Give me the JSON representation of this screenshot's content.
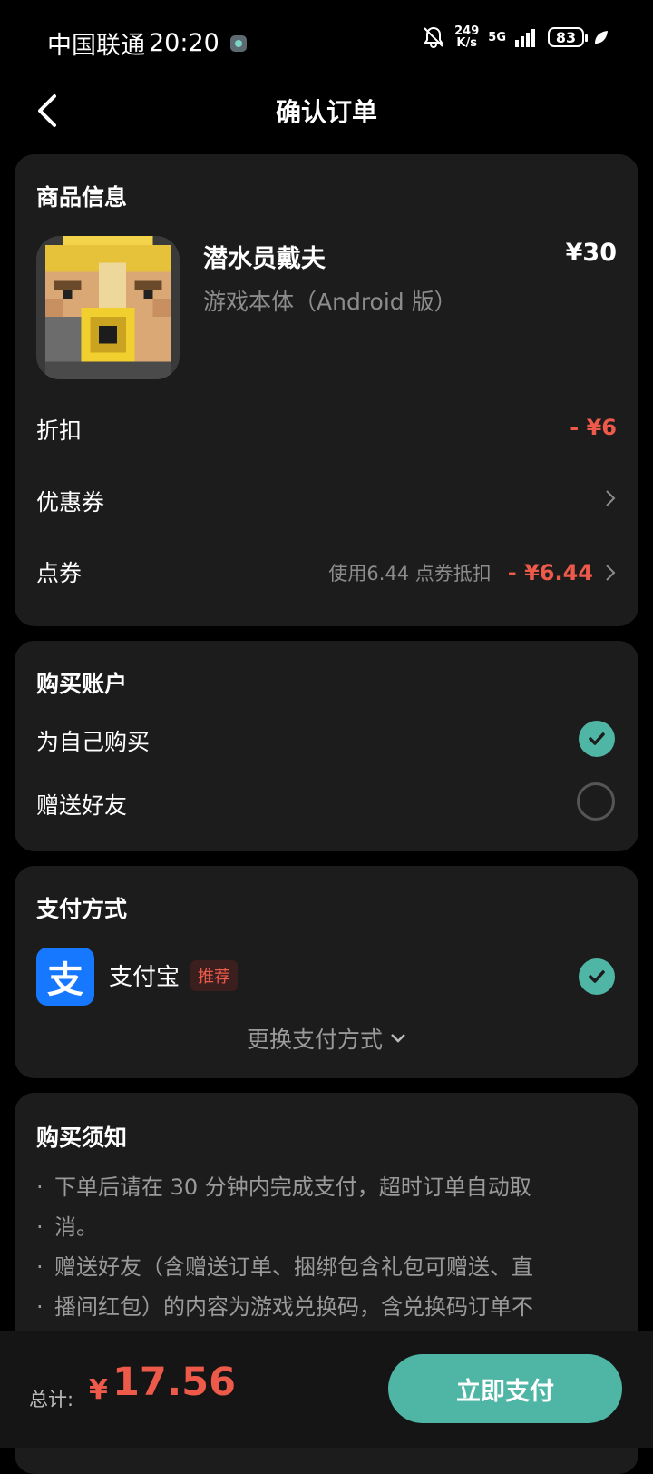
{
  "status_bar": {
    "carrier": "中国联通",
    "time": "20:20",
    "speed_top": "249",
    "speed_bottom": "K/s",
    "network": "5G",
    "battery": "83"
  },
  "nav": {
    "title": "确认订单"
  },
  "product_card": {
    "title": "商品信息",
    "name": "潜水员戴夫",
    "price": "¥30",
    "subtitle": "游戏本体（Android 版）",
    "discount_label": "折扣",
    "discount_value": "- ¥6",
    "coupon_label": "优惠券",
    "points_label": "点券",
    "points_hint": "使用6.44 点券抵扣",
    "points_value": "- ¥6.44"
  },
  "account_card": {
    "title": "购买账户",
    "option_self": "为自己购买",
    "option_gift": "赠送好友",
    "selected": "self"
  },
  "payment_card": {
    "title": "支付方式",
    "method_icon_char": "支",
    "method_name": "支付宝",
    "badge": "推荐",
    "change_label": "更换支付方式"
  },
  "notice_card": {
    "title": "购买须知",
    "lines": [
      "下单后请在 30 分钟内完成支付，超时订单自动取",
      "消。",
      "赠送好友（含赠送订单、捆绑包含礼包可赠送、直",
      "播间红包）的内容为游戏兑换码，含兑换码订单不"
    ]
  },
  "footer": {
    "total_label": "总计:",
    "currency": "¥",
    "total": "17.56",
    "pay_button": "立即支付"
  },
  "colors": {
    "accent": "#4fb5a4",
    "price_red": "#ee5a4a",
    "card_bg": "#1c1c1c",
    "alipay_blue": "#1677ff"
  }
}
